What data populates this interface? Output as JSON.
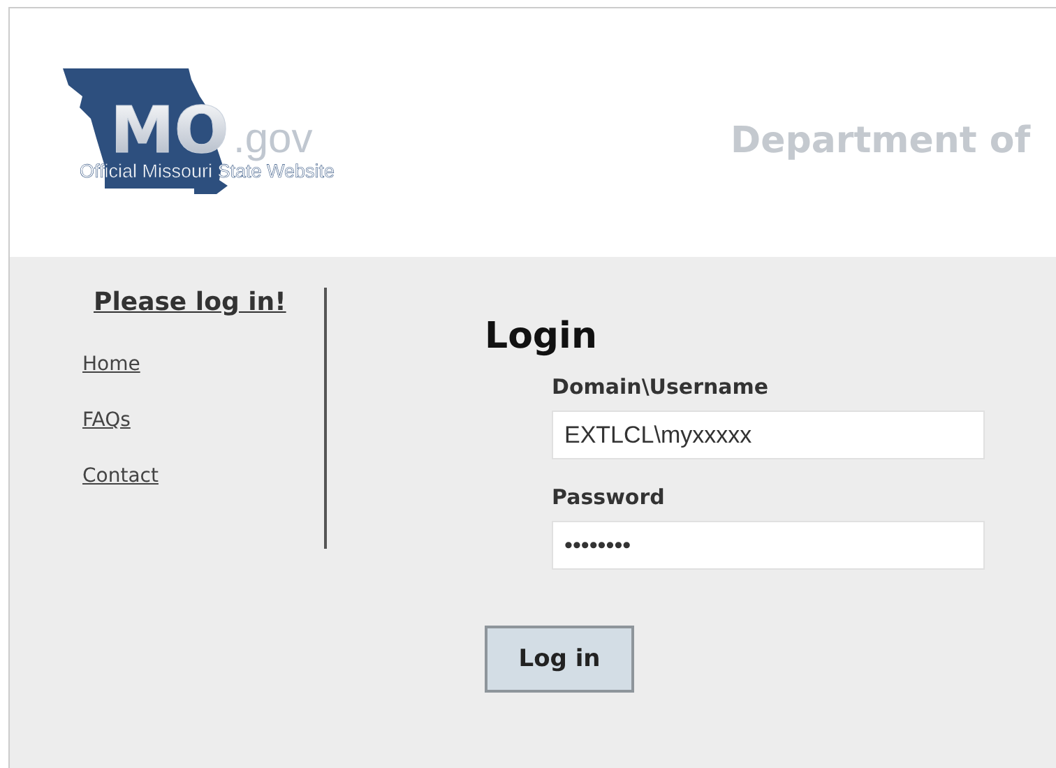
{
  "header": {
    "logo": {
      "mark": "MO",
      "suffix": ".gov",
      "tagline": "Official Missouri State Website"
    },
    "title": "Department of"
  },
  "sidebar": {
    "heading": "Please log in!",
    "links": [
      {
        "label": "Home"
      },
      {
        "label": "FAQs"
      },
      {
        "label": "Contact"
      }
    ]
  },
  "login": {
    "title": "Login",
    "fields": [
      {
        "label": "Domain\\Username",
        "value": "EXTLCL\\myxxxxx"
      },
      {
        "label": "Password",
        "value": "••••••••"
      }
    ],
    "button": "Log in"
  }
}
